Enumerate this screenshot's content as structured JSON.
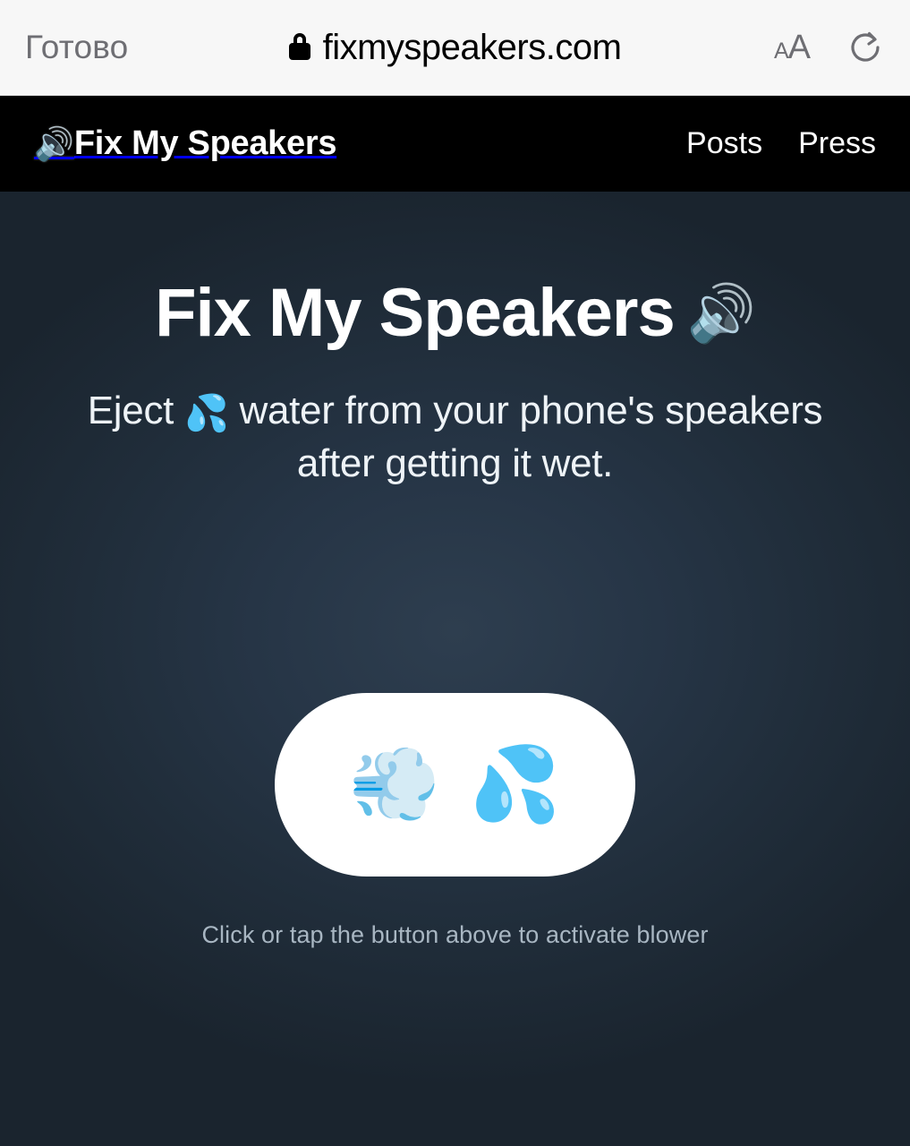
{
  "browser": {
    "done_label": "Готово",
    "lock_icon": "lock-icon",
    "url": "fixmyspeakers.com",
    "text_size_small": "A",
    "text_size_large": "A",
    "reload_icon": "reload-icon",
    "colors": {
      "bar_bg": "#f7f7f7",
      "text": "#6e6e73",
      "url_text": "#000000"
    }
  },
  "nav": {
    "brand_emoji": "🔊",
    "brand_label": "Fix My Speakers",
    "links": [
      {
        "label": "Posts"
      },
      {
        "label": "Press"
      }
    ],
    "colors": {
      "bg": "#000000",
      "text": "#ffffff"
    }
  },
  "hero": {
    "title": "Fix My Speakers",
    "title_emoji": "🔊",
    "subtitle_part1": "Eject",
    "subtitle_emoji": "💦",
    "subtitle_part2": "water from your phone's speakers after getting it wet.",
    "colors": {
      "bg_center": "#2e3e4f",
      "bg_edge": "#1a242e",
      "text": "#ffffff"
    }
  },
  "action": {
    "button_emoji_wind": "💨",
    "button_emoji_droplets": "💦",
    "hint": "Click or tap the button above to activate blower",
    "colors": {
      "button_bg": "#ffffff",
      "hint_text": "#a8b6c2"
    }
  }
}
